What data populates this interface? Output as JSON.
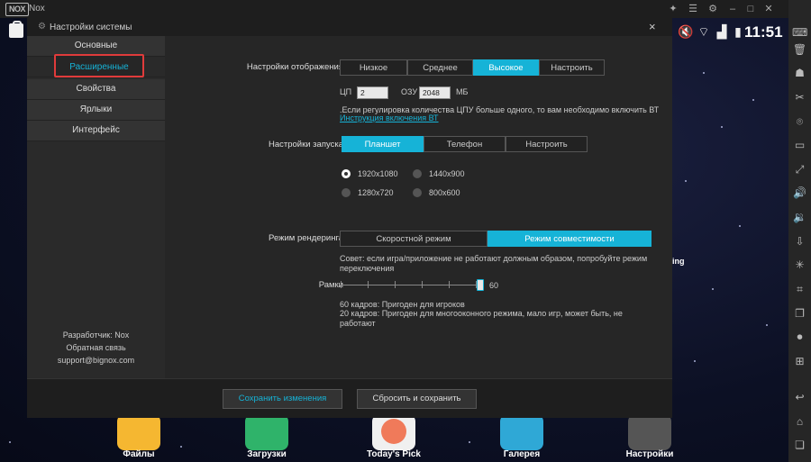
{
  "window": {
    "logo": "NOX",
    "title": "Nox"
  },
  "titlebar_icons": [
    "pin-icon",
    "menu-icon",
    "gear-icon",
    "minimize-icon",
    "maximize-icon",
    "close-icon"
  ],
  "status_bar": {
    "time": "11:51"
  },
  "dialog": {
    "title": "Настройки системы",
    "close": "×",
    "nav": [
      "Основные",
      "Расширенные",
      "Свойства",
      "Ярлыки",
      "Интерфейс"
    ],
    "active_nav": "Расширенные",
    "developer": "Разработчик: Nox",
    "feedback": "Обратная связь",
    "support": "support@bignox.com"
  },
  "display": {
    "label": "Настройки отображения",
    "options": [
      "Низкое",
      "Среднее",
      "Высокое",
      "Настроить"
    ],
    "selected": "Высокое",
    "cpu_label": "ЦП",
    "cpu_value": "2",
    "ram_label": "ОЗУ",
    "ram_value": "2048",
    "ram_unit": "МБ",
    "note": ".Если регулировка количества ЦПУ больше одного, то вам необходимо включить ВТ",
    "link": "Инструкция включения ВТ"
  },
  "launch": {
    "label": "Настройки запуска",
    "options": [
      "Планшет",
      "Телефон",
      "Настроить"
    ],
    "selected": "Планшет",
    "resolutions": [
      "1920x1080",
      "1440x900",
      "1280x720",
      "800x600"
    ],
    "selected_resolution": "1920x1080"
  },
  "render": {
    "label": "Режим рендеринга",
    "options": [
      "Скоростной режим",
      "Режим совместимости"
    ],
    "selected": "Режим совместимости",
    "tip": "Совет: если игра/приложение не работают должным образом, попробуйте режим переключения"
  },
  "frames": {
    "label": "Рамки",
    "value": "60",
    "level": 1.0,
    "note1": "60 кадров: Пригоден для игроков",
    "note2": "20 кадров: Пригоден для многооконного режима, мало игр, может быть, не работают"
  },
  "buttons": {
    "save": "Сохранить изменения",
    "reset": "Сбросить и сохранить"
  },
  "dock": [
    {
      "label": "Файлы",
      "color": "#f5b731"
    },
    {
      "label": "Загрузки",
      "color": "#2fb36a"
    },
    {
      "label": "Today's Pick",
      "color": "#f07a5a"
    },
    {
      "label": "Галерея",
      "color": "#2fa8d6"
    },
    {
      "label": "Настройки",
      "color": "#555"
    }
  ],
  "edge_text": "ing",
  "colors": {
    "accent": "#16b3d7",
    "highlight_border": "#e03b3b"
  }
}
